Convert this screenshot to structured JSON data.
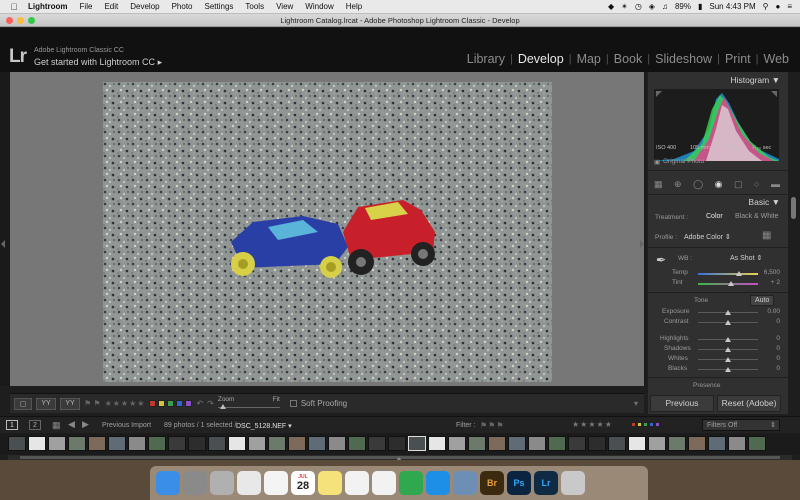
{
  "menubar": {
    "app_name": "Lightroom",
    "menus": [
      "File",
      "Edit",
      "Develop",
      "Photo",
      "Settings",
      "Tools",
      "View",
      "Window",
      "Help"
    ],
    "battery": "89%",
    "clock": "Sun 4:43 PM"
  },
  "window": {
    "title": "Lightroom Catalog.lrcat - Adobe Photoshop Lightroom Classic - Develop"
  },
  "identity": {
    "logo": "Lr",
    "line1": "Adobe Lightroom Classic CC",
    "line2": "Get started with Lightroom CC"
  },
  "modules": [
    {
      "label": "Library",
      "active": false
    },
    {
      "label": "Develop",
      "active": true
    },
    {
      "label": "Map",
      "active": false
    },
    {
      "label": "Book",
      "active": false
    },
    {
      "label": "Slideshow",
      "active": false
    },
    {
      "label": "Print",
      "active": false
    },
    {
      "label": "Web",
      "active": false
    }
  ],
  "histogram": {
    "title": "Histogram",
    "iso": "ISO 400",
    "focal": "105 mm",
    "aperture": "f / 22",
    "shutter": "¹⁄₁₀₀ sec",
    "original_photo": "Original Photo"
  },
  "basic": {
    "title": "Basic",
    "treatment_label": "Treatment :",
    "treatment_color": "Color",
    "treatment_bw": "Black & White",
    "profile_label": "Profile :",
    "profile_value": "Adobe Color",
    "wb_label": "WB :",
    "wb_value": "As Shot",
    "temp_label": "Temp",
    "temp_value": "6,500",
    "tint_label": "Tint",
    "tint_value": "+ 2",
    "tone_label": "Tone",
    "auto_label": "Auto",
    "exposure_label": "Exposure",
    "exposure_value": "0.00",
    "contrast_label": "Contrast",
    "contrast_value": "0",
    "highlights_label": "Highlights",
    "highlights_value": "0",
    "shadows_label": "Shadows",
    "shadows_value": "0",
    "whites_label": "Whites",
    "whites_value": "0",
    "blacks_label": "Blacks",
    "blacks_value": "0",
    "presence_label": "Presence"
  },
  "toolbar": {
    "zoom_label": "Zoom",
    "fit_label": "Fit",
    "soft_proofing": "Soft Proofing"
  },
  "buttons": {
    "previous": "Previous",
    "reset": "Reset (Adobe)"
  },
  "filmstrip": {
    "page1": "1",
    "page2": "2",
    "source": "Previous Import",
    "count": "89 photos / 1 selected /",
    "filename": "DSC_5128.NEF",
    "filter_label": "Filter :",
    "filters_off": "Filters Off"
  },
  "dock": {
    "calendar_day": "28",
    "calendar_month": "JUL",
    "apps": [
      {
        "name": "finder-icon",
        "color": "#3a8ee6",
        "label": ""
      },
      {
        "name": "system-preferences-icon",
        "color": "#8a8a8a",
        "label": ""
      },
      {
        "name": "launchpad-icon",
        "color": "#b0b0b0",
        "label": ""
      },
      {
        "name": "chrome-icon",
        "color": "#e8e8e8",
        "label": ""
      },
      {
        "name": "photos-icon",
        "color": "#f4f4f4",
        "label": ""
      },
      {
        "name": "calendar-icon",
        "color": "#ffffff",
        "label": ""
      },
      {
        "name": "notes-icon",
        "color": "#f5e27a",
        "label": ""
      },
      {
        "name": "reminders-icon",
        "color": "#f2f2f2",
        "label": ""
      },
      {
        "name": "itunes-icon",
        "color": "#f2f2f2",
        "label": ""
      },
      {
        "name": "numbers-icon",
        "color": "#2fa84f",
        "label": ""
      },
      {
        "name": "app-store-icon",
        "color": "#1e8fe6",
        "label": ""
      },
      {
        "name": "preview-icon",
        "color": "#6d8fb5",
        "label": ""
      },
      {
        "name": "bridge-icon",
        "color": "#3c2a10",
        "label": "Br"
      },
      {
        "name": "photoshop-icon",
        "color": "#0b2540",
        "label": "Ps"
      },
      {
        "name": "lightroom-icon",
        "color": "#0f2b44",
        "label": "Lr"
      },
      {
        "name": "trash-icon",
        "color": "#c9c9c9",
        "label": ""
      }
    ]
  }
}
